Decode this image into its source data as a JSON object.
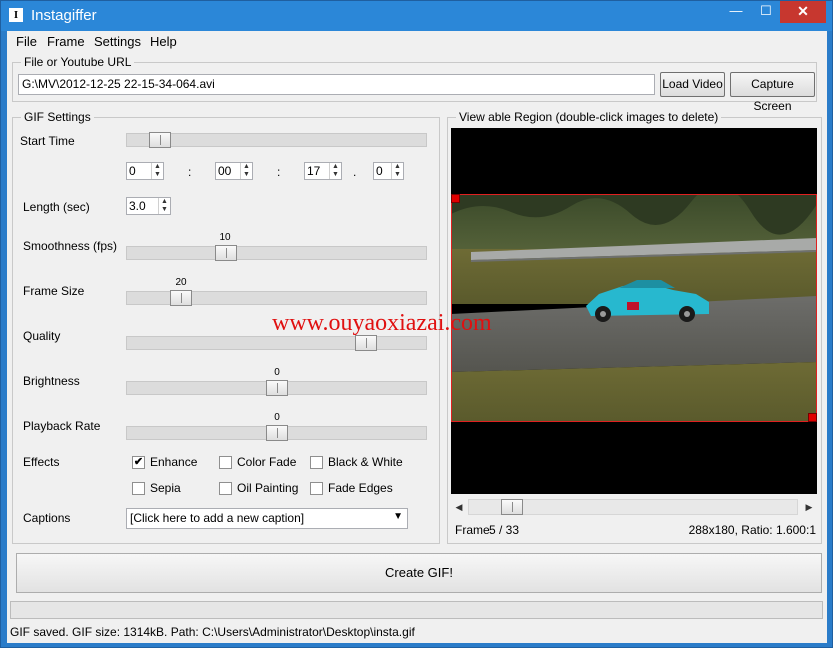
{
  "window": {
    "title": "Instagiffer",
    "icon_letter": "I",
    "min_glyph": "—",
    "max_glyph": "☐",
    "close_glyph": "✕"
  },
  "menu": {
    "items": [
      "File",
      "Frame",
      "Settings",
      "Help"
    ]
  },
  "source": {
    "group_label": "File or Youtube URL",
    "value": "G:\\MV\\2012-12-25 22-15-34-064.avi",
    "load_label": "Load Video",
    "capture_label": "Capture Screen"
  },
  "gif_settings": {
    "group_label": "GIF Settings",
    "start_time": {
      "label": "Start Time",
      "level": 0.11,
      "hours": "0",
      "minutes": "00",
      "seconds": "17",
      "ms": "0",
      "colon": ":",
      "dot": "."
    },
    "length": {
      "label": "Length (sec)",
      "value": "3.0"
    },
    "smoothness": {
      "label": "Smoothness (fps)",
      "value": "10",
      "level": 0.33
    },
    "frame_size": {
      "label": "Frame Size",
      "value": "20",
      "level": 0.18
    },
    "quality": {
      "label": "Quality",
      "level": 0.8
    },
    "brightness": {
      "label": "Brightness",
      "value": "0",
      "level": 0.5
    },
    "playback_rate": {
      "label": "Playback Rate",
      "value": "0",
      "level": 0.5
    },
    "effects": {
      "label": "Effects",
      "options": [
        {
          "label": "Enhance",
          "checked": true
        },
        {
          "label": "Color Fade",
          "checked": false
        },
        {
          "label": "Black & White",
          "checked": false
        },
        {
          "label": "Sepia",
          "checked": false
        },
        {
          "label": "Oil Painting",
          "checked": false
        },
        {
          "label": "Fade Edges",
          "checked": false
        }
      ],
      "check_glyph": "✔"
    },
    "captions": {
      "label": "Captions",
      "value": "[Click here to add a new caption]"
    }
  },
  "viewable": {
    "group_label": "View able Region (double-click images to delete)",
    "frame_label": "Frame",
    "frame_value": "5 / 33",
    "frame_level": 0.13,
    "size_info": "288x180, Ratio: 1.600:1"
  },
  "create_label": "Create GIF!",
  "status": "GIF saved. GIF size: 1314kB. Path: C:\\Users\\Administrator\\Desktop\\insta.gif",
  "watermark": "www.ouyaoxiazai.com",
  "colors": {
    "title_bar": "#2b87d8",
    "close": "#c7372f",
    "selection": "#e02020",
    "car": "#27b8cf",
    "watermark": "#e01010"
  }
}
